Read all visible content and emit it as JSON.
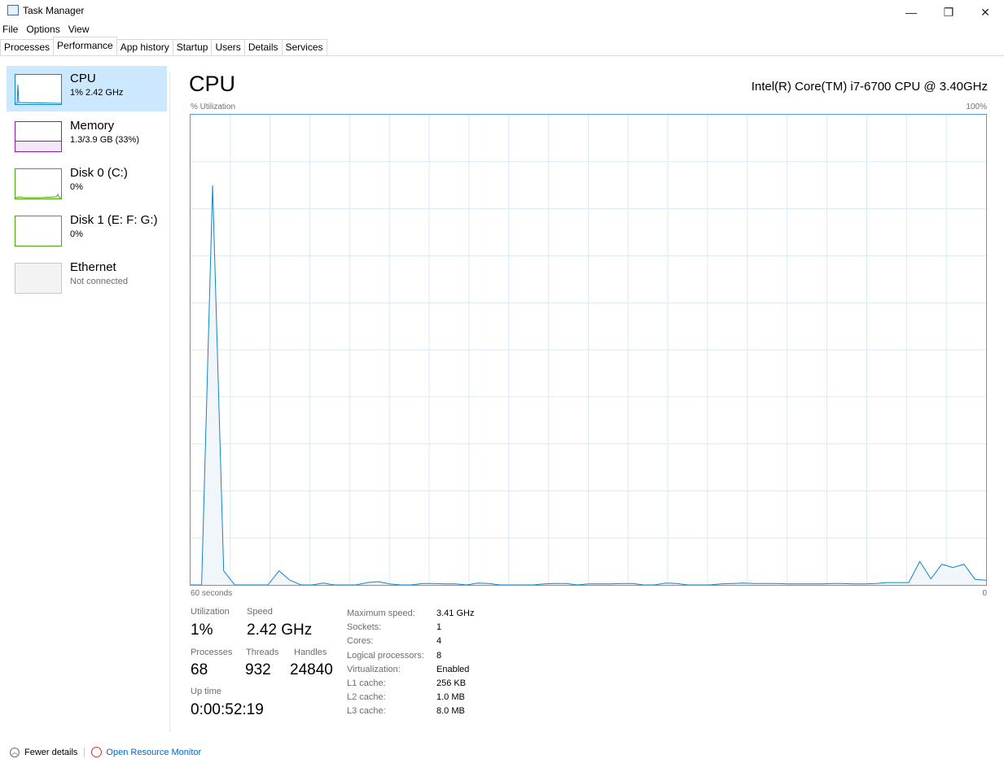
{
  "window": {
    "title": "Task Manager",
    "minimize_glyph": "—",
    "restore_glyph": "❐",
    "close_glyph": "✕"
  },
  "menu": [
    "File",
    "Options",
    "View"
  ],
  "tabs": [
    "Processes",
    "Performance",
    "App history",
    "Startup",
    "Users",
    "Details",
    "Services"
  ],
  "active_tab": "Performance",
  "sidebar": [
    {
      "title": "CPU",
      "sub": "1% 2.42 GHz",
      "color": "#1185c8",
      "active": true
    },
    {
      "title": "Memory",
      "sub": "1.3/3.9 GB (33%)",
      "color": "#8b1fa9",
      "active": false
    },
    {
      "title": "Disk 0 (C:)",
      "sub": "0%",
      "color": "#4da60c",
      "active": false
    },
    {
      "title": "Disk 1 (E: F: G:)",
      "sub": "0%",
      "color": "#4da60c",
      "active": false
    },
    {
      "title": "Ethernet",
      "sub": "Not connected",
      "color": "#b0b0b0",
      "active": false
    }
  ],
  "main": {
    "title": "CPU",
    "cpu_name": "Intel(R) Core(TM) i7-6700 CPU @ 3.40GHz",
    "y_label": "% Utilization",
    "y_max_label": "100%",
    "x_left_label": "60 seconds",
    "x_right_label": "0"
  },
  "chart_data": {
    "type": "area",
    "x_label": "60 seconds",
    "y_label": "% Utilization",
    "ylim": [
      0,
      100
    ],
    "xlim": [
      60,
      0
    ],
    "series": [
      {
        "values": [
          0,
          0,
          85,
          3,
          0,
          0,
          0,
          0,
          3,
          1,
          0,
          0,
          0.4,
          0,
          0,
          0,
          0.5,
          0.7,
          0.2,
          0,
          0,
          0.3,
          0.3,
          0.2,
          0.2,
          0,
          0.4,
          0.3,
          0,
          0,
          0,
          0,
          0.2,
          0.3,
          0.3,
          0,
          0.2,
          0.2,
          0.2,
          0.3,
          0.3,
          0,
          0,
          0.4,
          0.3,
          0,
          0,
          0,
          0.2,
          0.3,
          0.4,
          0.3,
          0.3,
          0.3,
          0.2,
          0.2,
          0.2,
          0.2,
          0.3,
          0.3,
          0.2,
          0.2,
          0.3,
          0.5,
          0.5,
          0.5,
          5,
          1.3,
          4.4,
          3.7,
          4.4,
          1.2,
          1
        ]
      }
    ],
    "grid": true,
    "line_color": "#1185c8",
    "fill_color": "#f1f6fa"
  },
  "stats": {
    "utilization_label": "Utilization",
    "utilization": "1%",
    "speed_label": "Speed",
    "speed": "2.42 GHz",
    "processes_label": "Processes",
    "processes": "68",
    "threads_label": "Threads",
    "threads": "932",
    "handles_label": "Handles",
    "handles": "24840",
    "uptime_label": "Up time",
    "uptime": "0:00:52:19"
  },
  "specs": [
    {
      "label": "Maximum speed:",
      "value": "3.41 GHz"
    },
    {
      "label": "Sockets:",
      "value": "1"
    },
    {
      "label": "Cores:",
      "value": "4"
    },
    {
      "label": "Logical processors:",
      "value": "8"
    },
    {
      "label": "Virtualization:",
      "value": "Enabled"
    },
    {
      "label": "L1 cache:",
      "value": "256 KB"
    },
    {
      "label": "L2 cache:",
      "value": "1.0 MB"
    },
    {
      "label": "L3 cache:",
      "value": "8.0 MB"
    }
  ],
  "footer": {
    "fewer_details": "Fewer details",
    "open_monitor": "Open Resource Monitor"
  }
}
